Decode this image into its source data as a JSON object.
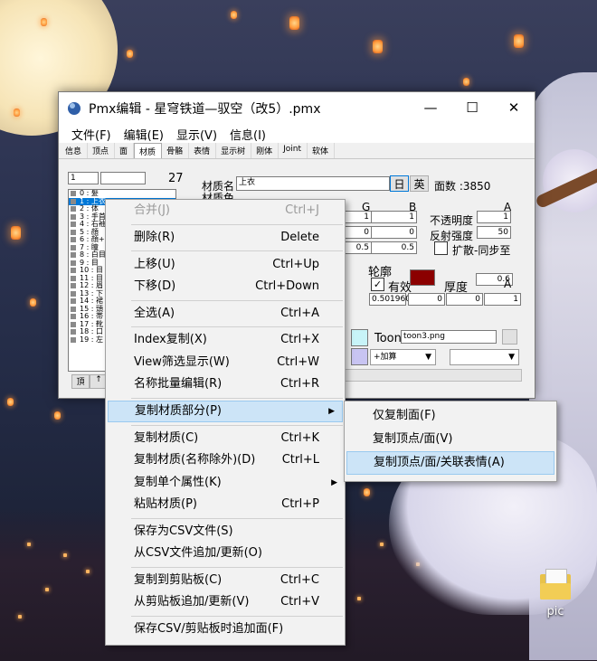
{
  "window": {
    "title": "Pmx编辑 - 星穹铁道—驭空（改5）.pmx",
    "minimize": "—",
    "maximize": "☐",
    "close": "✕"
  },
  "menubar": [
    "文件(F)",
    "编辑(E)",
    "显示(V)",
    "信息(I)"
  ],
  "tabs": [
    "信息",
    "顶点",
    "面",
    "材质",
    "骨骼",
    "表情",
    "显示树",
    "刚体",
    "Joint",
    "软体"
  ],
  "active_tab": "材质",
  "material_panel": {
    "index_value": "1",
    "count": "27",
    "name_label": "材质名",
    "name_value": "上衣",
    "lang_jp": "日",
    "lang_en": "英",
    "face_count": "面数 :3850",
    "color_label": "材质色",
    "col_g": "G",
    "col_b": "B",
    "col_a": "A",
    "opacity_label": "不透明度",
    "reflect_label": "反射强度",
    "reflect_value": "50",
    "diffuse_rgba": [
      "1",
      "1",
      "1"
    ],
    "row2": [
      "0",
      "0"
    ],
    "row3": [
      "0.5",
      "0.5"
    ],
    "spread_label": "扩散-同步至",
    "outline_label": "轮廓",
    "outline_color": "#8b0000",
    "enabled_label": "有效",
    "thickness_label": "厚度",
    "thickness_value": "0.6",
    "outline_rgba": [
      "0.501960",
      "0",
      "0",
      "1"
    ],
    "toon_label": "Toon",
    "toon_value": "toon3.png",
    "blend_value": "+加算",
    "list_items": [
      "0 : 髪",
      "1 : 上衣",
      "2 : 体",
      "3 : 手首",
      "4 : 右袖",
      "5 : 顔",
      "6 : 顔+",
      "7 : 瞳",
      "8 : 白目",
      "9 : 目",
      "10 : 目",
      "11 : 目",
      "12 : 眉",
      "13 : 下",
      "14 : 裙",
      "15 : 頭",
      "16 : 帯",
      "17 : 靴",
      "18 : 口",
      "19 : 左"
    ],
    "list_btn_top": "頂",
    "list_btn_up": "↑"
  },
  "context_menu": [
    {
      "label": "合并(J)",
      "shortcut": "Ctrl+J",
      "disabled": true
    },
    {
      "sep": true
    },
    {
      "label": "删除(R)",
      "shortcut": "Delete"
    },
    {
      "sep": true
    },
    {
      "label": "上移(U)",
      "shortcut": "Ctrl+Up"
    },
    {
      "label": "下移(D)",
      "shortcut": "Ctrl+Down"
    },
    {
      "sep": true
    },
    {
      "label": "全选(A)",
      "shortcut": "Ctrl+A"
    },
    {
      "sep": true
    },
    {
      "label": "Index复制(X)",
      "shortcut": "Ctrl+X"
    },
    {
      "label": "View筛选显示(W)",
      "shortcut": "Ctrl+W"
    },
    {
      "label": "名称批量编辑(R)",
      "shortcut": "Ctrl+R"
    },
    {
      "sep": true
    },
    {
      "label": "复制材质部分(P)",
      "shortcut": "",
      "submenu": true,
      "highlighted": true
    },
    {
      "sep": true
    },
    {
      "label": "复制材质(C)",
      "shortcut": "Ctrl+K"
    },
    {
      "label": "复制材质(名称除外)(D)",
      "shortcut": "Ctrl+L"
    },
    {
      "label": "复制单个属性(K)",
      "shortcut": "",
      "submenu": true
    },
    {
      "label": "粘贴材质(P)",
      "shortcut": "Ctrl+P"
    },
    {
      "sep": true
    },
    {
      "label": "保存为CSV文件(S)",
      "shortcut": ""
    },
    {
      "label": "从CSV文件追加/更新(O)",
      "shortcut": ""
    },
    {
      "sep": true
    },
    {
      "label": "复制到剪贴板(C)",
      "shortcut": "Ctrl+C"
    },
    {
      "label": "从剪贴板追加/更新(V)",
      "shortcut": "Ctrl+V"
    },
    {
      "sep": true
    },
    {
      "label": "保存CSV/剪贴板时追加面(F)",
      "shortcut": ""
    }
  ],
  "submenu": [
    {
      "label": "仅复制面(F)"
    },
    {
      "label": "复制顶点/面(V)"
    },
    {
      "label": "复制顶点/面/关联表情(A)",
      "highlighted": true
    }
  ],
  "desktop_icon": {
    "label": "pic"
  }
}
